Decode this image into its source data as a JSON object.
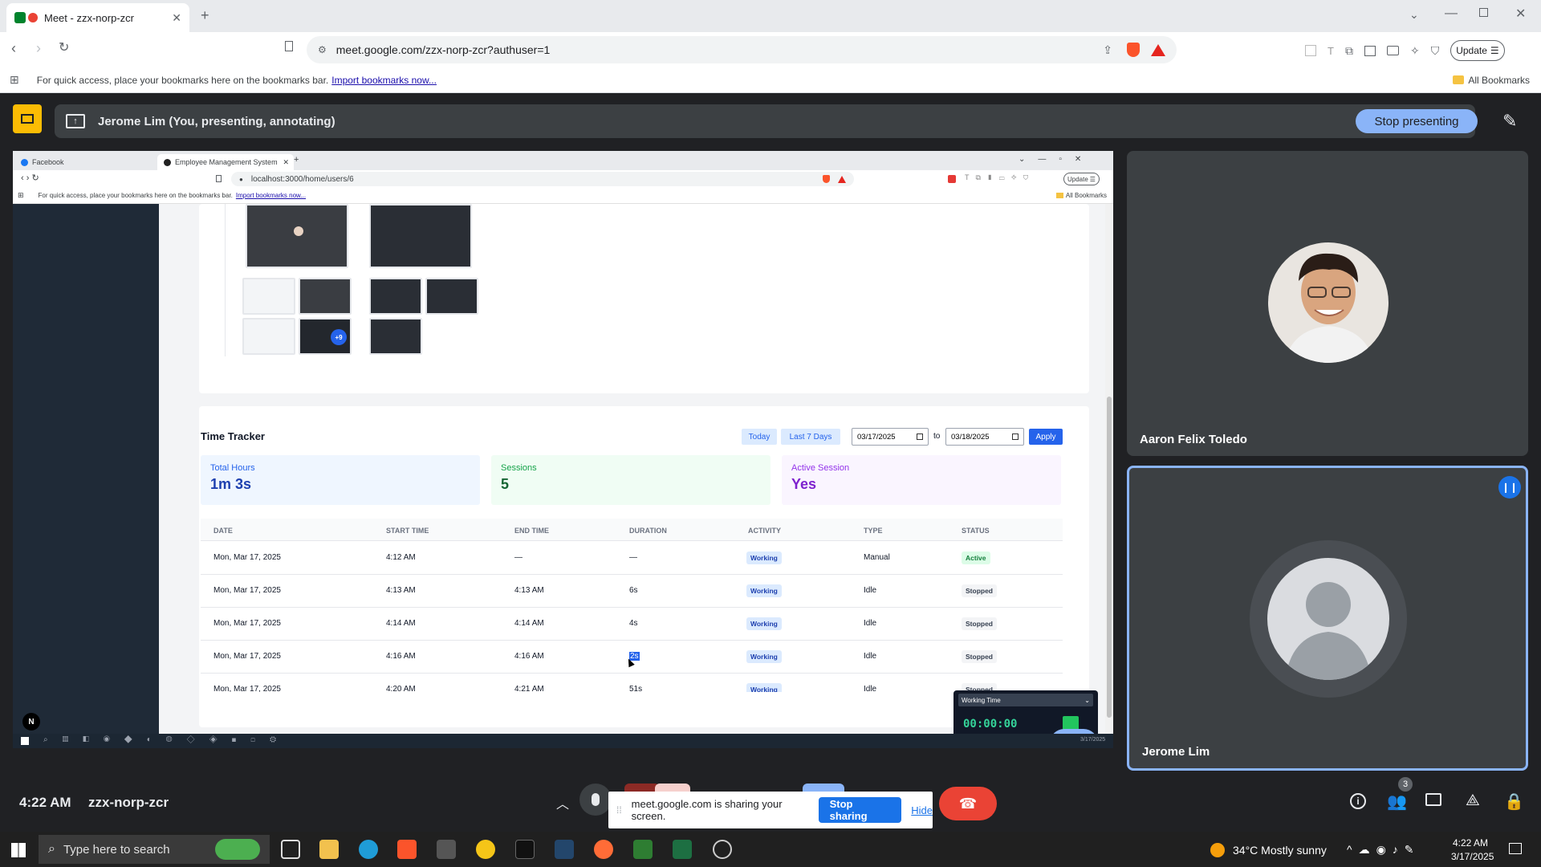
{
  "browser": {
    "tab_title": "Meet - zzx-norp-zcr",
    "url": "meet.google.com/zzx-norp-zcr?authuser=1",
    "update_label": "Update",
    "bookmarks_prompt": "For quick access, place your bookmarks here on the bookmarks bar.",
    "import_link": "Import bookmarks now...",
    "all_bookmarks": "All Bookmarks"
  },
  "meet": {
    "presenting_text": "Jerome Lim (You, presenting, annotating)",
    "stop_presenting": "Stop presenting",
    "time": "4:22 AM",
    "meeting_code": "zzx-norp-zcr",
    "participants_count": "3",
    "participants": [
      {
        "name": "Aaron Felix Toledo"
      },
      {
        "name": "Jerome Lim"
      }
    ],
    "sharing_text": "meet.google.com is sharing your screen.",
    "stop_sharing": "Stop sharing",
    "hide": "Hide"
  },
  "shared_screen": {
    "tabs": [
      "Facebook",
      "Employee Management System"
    ],
    "url": "localhost:3000/home/users/6",
    "update_label": "Update",
    "bookmarks_prompt": "For quick access, place your bookmarks here on the bookmarks bar.",
    "import_link": "Import bookmarks now...",
    "all_bookmarks": "All Bookmarks",
    "thumb_badge": "+9",
    "avatar_letter": "N",
    "date_footer": "3/17/2025",
    "time_tracker": {
      "title": "Time Tracker",
      "today": "Today",
      "last7": "Last 7 Days",
      "from_date": "03/17/2025",
      "to_label": "to",
      "to_date": "03/18/2025",
      "apply": "Apply",
      "stats": [
        {
          "label": "Total Hours",
          "value": "1m 3s"
        },
        {
          "label": "Sessions",
          "value": "5"
        },
        {
          "label": "Active Session",
          "value": "Yes"
        }
      ],
      "columns": [
        "DATE",
        "START TIME",
        "END TIME",
        "DURATION",
        "ACTIVITY",
        "TYPE",
        "STATUS"
      ],
      "rows": [
        {
          "date": "Mon, Mar 17, 2025",
          "start": "4:12 AM",
          "end": "—",
          "duration": "—",
          "activity": "Working",
          "type": "Manual",
          "status": "Active"
        },
        {
          "date": "Mon, Mar 17, 2025",
          "start": "4:13 AM",
          "end": "4:13 AM",
          "duration": "6s",
          "activity": "Working",
          "type": "Idle",
          "status": "Stopped"
        },
        {
          "date": "Mon, Mar 17, 2025",
          "start": "4:14 AM",
          "end": "4:14 AM",
          "duration": "4s",
          "activity": "Working",
          "type": "Idle",
          "status": "Stopped"
        },
        {
          "date": "Mon, Mar 17, 2025",
          "start": "4:16 AM",
          "end": "4:16 AM",
          "duration": "2s",
          "activity": "Working",
          "type": "Idle",
          "status": "Stopped"
        },
        {
          "date": "Mon, Mar 17, 2025",
          "start": "4:20 AM",
          "end": "4:21 AM",
          "duration": "51s",
          "activity": "Working",
          "type": "Idle",
          "status": "Stopped"
        }
      ]
    },
    "widget": {
      "select": "Working Time",
      "timer": "00:00:00"
    }
  },
  "windows": {
    "search_placeholder": "Type here to search",
    "weather": "34°C  Mostly sunny",
    "clock_time": "4:22 AM",
    "clock_date": "3/17/2025"
  }
}
